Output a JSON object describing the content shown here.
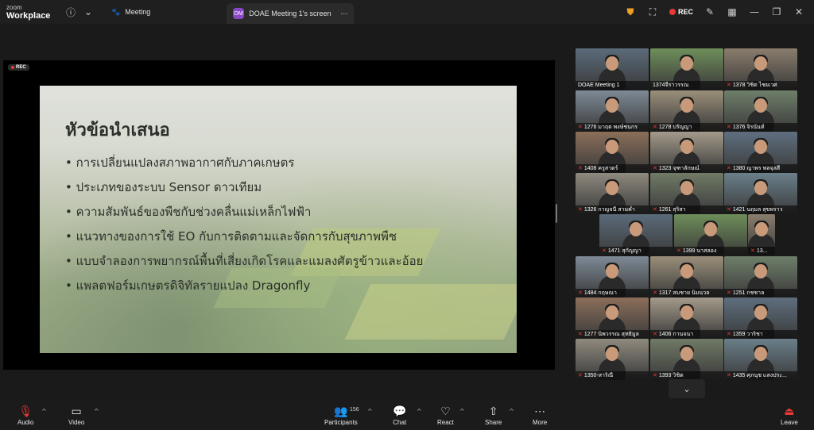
{
  "app": {
    "logo_line1": "zoom",
    "logo_line2": "Workplace"
  },
  "tabs": [
    {
      "label": "Meeting",
      "active": false
    },
    {
      "label": "DOAE Meeting 1's screen",
      "badge": "DM",
      "active": true
    }
  ],
  "topbar": {
    "rec_label": "REC"
  },
  "share": {
    "rec_tag": "REC",
    "slide_title": "หัวข้อนำเสนอ",
    "bullets": [
      "การเปลี่ยนแปลงสภาพอากาศกับภาคเกษตร",
      "ประเภทของระบบ Sensor ดาวเทียม",
      "ความสัมพันธ์ของพืชกับช่วงคลื่นแม่เหล็กไฟฟ้า",
      "แนวทางของการใช้ EO กับการติดตามและจัดการกับสุขภาพพืช",
      "แบบจำลองการพยากรณ์พื้นที่เสี่ยงเกิดโรคและแมลงศัตรูข้าวและอ้อย",
      "แพลตฟอร์มเกษตรดิจิทัลรายแปลง Dragonfly"
    ]
  },
  "participants_tiles": [
    {
      "name": "DOAE Meeting 1",
      "muted": false,
      "active": true
    },
    {
      "name": "1374จีราวรรณ",
      "muted": false
    },
    {
      "name": "1378 วิชิต ไชยเวศ",
      "muted": true
    },
    {
      "name": "1276 มาฤต พงษ์ชนกร",
      "muted": true
    },
    {
      "name": "1278 ปรัญญา",
      "muted": true
    },
    {
      "name": "1376 จิรนันท์",
      "muted": true
    },
    {
      "name": "1408 ครูสาตร์",
      "muted": true
    },
    {
      "name": "1323 จุฑาลักษณ์",
      "muted": true
    },
    {
      "name": "1380 ญาพร พลจุลสี",
      "muted": true
    },
    {
      "name": "1326 กาญจนี สามค่ำ",
      "muted": true
    },
    {
      "name": "1261 สุริสา",
      "muted": true
    },
    {
      "name": "1421 นฤมล สุขพราว",
      "muted": true
    },
    {
      "name": "1471 สุกัญญา",
      "muted": true
    },
    {
      "name": "1399 นาสลอง",
      "muted": true
    },
    {
      "name": "13...",
      "muted": true
    },
    {
      "name": "1484 กฤษณา",
      "muted": true
    },
    {
      "name": "1317 สมชาย นิมนวล",
      "muted": true
    },
    {
      "name": "1251 กชชาล",
      "muted": true
    },
    {
      "name": "1277 นิพวรรณ สุทธิมูล",
      "muted": true
    },
    {
      "name": "1406 กานจนา",
      "muted": true
    },
    {
      "name": "1359 วาริชา",
      "muted": true
    },
    {
      "name": "1350-สาริณี",
      "muted": true
    },
    {
      "name": "1393 วิชิต",
      "muted": true
    },
    {
      "name": "1435 ศุภนุช แสงประ...",
      "muted": true
    }
  ],
  "toolbar": {
    "audio": "Audio",
    "video": "Video",
    "participants": "Participants",
    "participants_count": "156",
    "chat": "Chat",
    "react": "React",
    "share": "Share",
    "more": "More",
    "leave": "Leave"
  },
  "colors": {
    "active_speaker": "#3fd46a",
    "muted": "#e53935",
    "leave": "#e53935",
    "badge": "#8a46c4"
  },
  "icons": {
    "info": "info-icon",
    "chevron": "chevron-down-icon",
    "meeting": "paw-icon",
    "more_tab": "ellipsis-icon",
    "shield": "shield-icon",
    "layout": "layout-icon",
    "record": "cloud-record-icon",
    "pen": "pen-icon",
    "grid": "grid-icon",
    "minimize": "minimize-icon",
    "restore": "restore-icon",
    "close": "close-icon"
  }
}
